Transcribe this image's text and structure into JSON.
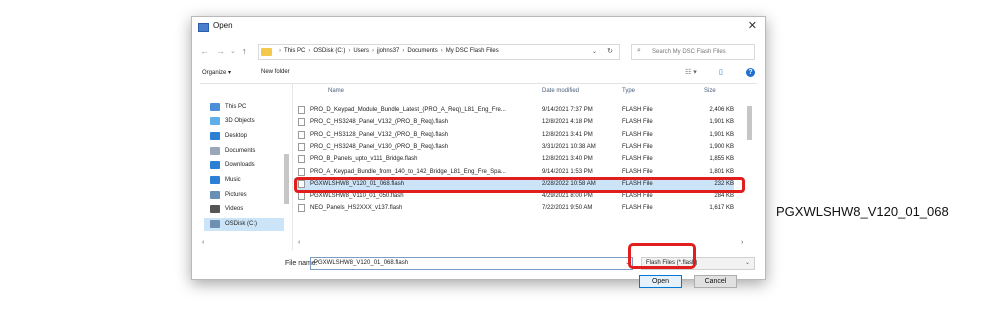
{
  "dialog": {
    "title": "Open",
    "close_glyph": "✕",
    "nav": {
      "back": "←",
      "forward": "→",
      "down": "⌄",
      "up": "↑"
    },
    "address": {
      "crumbs": [
        "This PC",
        "OSDisk (C:)",
        "Users",
        "jjohns37",
        "Documents",
        "My DSC Flash Files"
      ],
      "lead": "›",
      "sep": "›",
      "dropdown": "⌄",
      "refresh": "↻"
    },
    "search": {
      "placeholder": "Search My DSC Flash Files",
      "icon": "search-icon"
    },
    "toolbar": {
      "organize": "Organize ▾",
      "new_folder": "New folder",
      "view_glyph": "☷ ▾",
      "pane_glyph": "▯",
      "help": "?"
    },
    "sidebar": [
      {
        "label": "This PC",
        "icon": "computer-icon",
        "color": "#4a90d9"
      },
      {
        "label": "3D Objects",
        "icon": "cube-icon",
        "color": "#5fb0e8"
      },
      {
        "label": "Desktop",
        "icon": "desktop-icon",
        "color": "#2b7fd4"
      },
      {
        "label": "Documents",
        "icon": "document-icon",
        "color": "#9aa7b8"
      },
      {
        "label": "Downloads",
        "icon": "download-icon",
        "color": "#2b7fd4"
      },
      {
        "label": "Music",
        "icon": "music-icon",
        "color": "#2b7fd4"
      },
      {
        "label": "Pictures",
        "icon": "picture-icon",
        "color": "#6a8fb5"
      },
      {
        "label": "Videos",
        "icon": "video-icon",
        "color": "#555555"
      },
      {
        "label": "OSDisk (C:)",
        "icon": "drive-icon",
        "color": "#6f8fb0"
      }
    ],
    "columns": {
      "name": "Name",
      "date": "Date modified",
      "type": "Type",
      "size": "Size"
    },
    "files": [
      {
        "name": "PRO_D_Keypad_Module_Bundle_Latest_(PRO_A_Req)_L81_Eng_Fre...",
        "date": "9/14/2021 7:37 PM",
        "type": "FLASH File",
        "size": "2,406 KB"
      },
      {
        "name": "PRO_C_HS3248_Panel_V132_(PRO_B_Req).flash",
        "date": "12/8/2021 4:18 PM",
        "type": "FLASH File",
        "size": "1,901 KB"
      },
      {
        "name": "PRO_C_HS3128_Panel_V132_(PRO_B_Req).flash",
        "date": "12/8/2021 3:41 PM",
        "type": "FLASH File",
        "size": "1,901 KB"
      },
      {
        "name": "PRO_C_HS3248_Panel_V130_(PRO_B_Req).flash",
        "date": "3/31/2021 10:38 AM",
        "type": "FLASH File",
        "size": "1,900 KB"
      },
      {
        "name": "PRO_B_Panels_upto_v111_Bridge.flash",
        "date": "12/8/2021 3:40 PM",
        "type": "FLASH File",
        "size": "1,855 KB"
      },
      {
        "name": "PRO_A_Keypad_Bundle_from_140_to_142_Bridge_L81_Eng_Fre_Spa...",
        "date": "9/14/2021 1:53 PM",
        "type": "FLASH File",
        "size": "1,801 KB"
      },
      {
        "name": "PGXWLSHW8_V120_01_068.flash",
        "date": "2/28/2022 10:58 AM",
        "type": "FLASH File",
        "size": "232 KB",
        "selected": true
      },
      {
        "name": "PGXWLSHW8_V110_01_050.flash",
        "date": "4/29/2021 8:00 PM",
        "type": "FLASH File",
        "size": "284 KB"
      },
      {
        "name": "NEO_Panels_HS2XXX_v137.flash",
        "date": "7/22/2021 9:50 AM",
        "type": "FLASH File",
        "size": "1,617 KB"
      }
    ],
    "filename_label": "File name:",
    "filename_value": "PGXWLSHW8_V120_01_068.flash",
    "filetype": "Flash Files (*.flash)",
    "open_label": "Open",
    "cancel_label": "Cancel"
  },
  "callout": "PGXWLSHW8_V120_01_068",
  "highlight_color": "#e01e1e"
}
